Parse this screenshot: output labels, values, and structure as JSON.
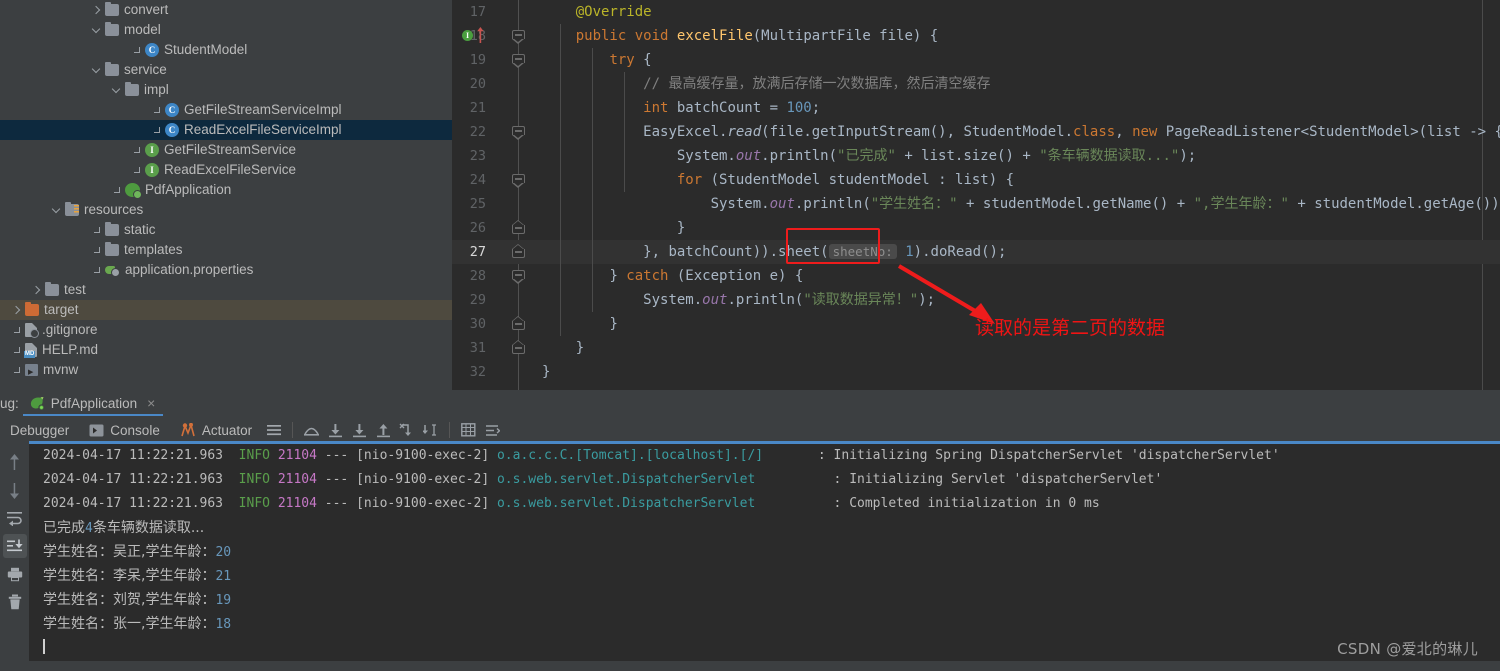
{
  "colors": {
    "editor_bg": "#2b2b2b",
    "panel_bg": "#3c3f41",
    "accent_blue": "#4a88c7",
    "selection_blue": "#0d293e",
    "annotation_red": "#ee1c1c",
    "string_green": "#6a8759",
    "keyword_orange": "#cc7832",
    "number_blue": "#6897bb"
  },
  "project_tree": {
    "items": [
      {
        "label": "convert",
        "indent": 5,
        "icon": "folder-icon",
        "chevron": "right",
        "state": "normal"
      },
      {
        "label": "model",
        "indent": 5,
        "icon": "folder-icon",
        "chevron": "down",
        "state": "normal"
      },
      {
        "label": "StudentModel",
        "indent": 7,
        "icon": "java-class-icon",
        "chevron": "none",
        "state": "normal"
      },
      {
        "label": "service",
        "indent": 5,
        "icon": "folder-icon",
        "chevron": "down",
        "state": "normal"
      },
      {
        "label": "impl",
        "indent": 6,
        "icon": "folder-icon",
        "chevron": "down",
        "state": "normal"
      },
      {
        "label": "GetFileStreamServiceImpl",
        "indent": 8,
        "icon": "java-class-icon",
        "chevron": "none",
        "state": "normal"
      },
      {
        "label": "ReadExcelFileServiceImpl",
        "indent": 8,
        "icon": "java-class-icon",
        "chevron": "none",
        "state": "selected"
      },
      {
        "label": "GetFileStreamService",
        "indent": 7,
        "icon": "java-interface-icon",
        "chevron": "none",
        "state": "normal"
      },
      {
        "label": "ReadExcelFileService",
        "indent": 7,
        "icon": "java-interface-icon",
        "chevron": "none",
        "state": "normal"
      },
      {
        "label": "PdfApplication",
        "indent": 6,
        "icon": "spring-boot-icon",
        "chevron": "none",
        "state": "normal"
      },
      {
        "label": "resources",
        "indent": 3,
        "icon": "resources-folder-icon",
        "chevron": "down",
        "state": "normal"
      },
      {
        "label": "static",
        "indent": 5,
        "icon": "folder-icon",
        "chevron": "none",
        "state": "normal"
      },
      {
        "label": "templates",
        "indent": 5,
        "icon": "folder-icon",
        "chevron": "none",
        "state": "normal"
      },
      {
        "label": "application.properties",
        "indent": 5,
        "icon": "properties-file-icon",
        "chevron": "none",
        "state": "normal"
      },
      {
        "label": "test",
        "indent": 2,
        "icon": "folder-icon",
        "chevron": "right",
        "state": "normal"
      },
      {
        "label": "target",
        "indent": 1,
        "icon": "target-folder-icon",
        "chevron": "right",
        "state": "highlighted"
      },
      {
        "label": ".gitignore",
        "indent": 1,
        "icon": "gitignore-file-icon",
        "chevron": "none",
        "state": "normal"
      },
      {
        "label": "HELP.md",
        "indent": 1,
        "icon": "markdown-file-icon",
        "chevron": "none",
        "state": "normal"
      },
      {
        "label": "mvnw",
        "indent": 1,
        "icon": "script-file-icon",
        "chevron": "none",
        "state": "normal"
      }
    ]
  },
  "editor": {
    "current_line": 27,
    "breakpoint_line": 18,
    "inlay_hint": "sheetNo:",
    "lines": [
      {
        "num": "17",
        "indent": 2,
        "tokens": [
          {
            "t": "anno",
            "v": "@Override"
          }
        ]
      },
      {
        "num": "18",
        "indent": 2,
        "tokens": [
          {
            "t": "kw",
            "v": "public "
          },
          {
            "t": "kw",
            "v": "void "
          },
          {
            "t": "meth",
            "v": "excelFile"
          },
          {
            "t": "def",
            "v": "(MultipartFile file) {"
          }
        ]
      },
      {
        "num": "19",
        "indent": 3,
        "tokens": [
          {
            "t": "kw",
            "v": "try"
          },
          {
            "t": "def",
            "v": " {"
          }
        ]
      },
      {
        "num": "20",
        "indent": 4,
        "tokens": [
          {
            "t": "cmt",
            "v": "// 最高缓存量，放满后存储一次数据库，然后清空缓存"
          }
        ]
      },
      {
        "num": "21",
        "indent": 4,
        "tokens": [
          {
            "t": "kw",
            "v": "int "
          },
          {
            "t": "def",
            "v": "batchCount = "
          },
          {
            "t": "num",
            "v": "100"
          },
          {
            "t": "def",
            "v": ";"
          }
        ]
      },
      {
        "num": "22",
        "indent": 4,
        "tokens": [
          {
            "t": "def",
            "v": "EasyExcel."
          },
          {
            "t": "stat",
            "v": "read"
          },
          {
            "t": "def",
            "v": "(file.getInputStream(), StudentModel."
          },
          {
            "t": "kw",
            "v": "class"
          },
          {
            "t": "def",
            "v": ", "
          },
          {
            "t": "kw",
            "v": "new "
          },
          {
            "t": "def",
            "v": "PageReadListener<StudentModel>(list -> {"
          }
        ]
      },
      {
        "num": "23",
        "indent": 5,
        "tokens": [
          {
            "t": "def",
            "v": "System."
          },
          {
            "t": "field",
            "v": "out"
          },
          {
            "t": "def",
            "v": ".println("
          },
          {
            "t": "str",
            "v": "\"已完成\""
          },
          {
            "t": "def",
            "v": " + list.size() + "
          },
          {
            "t": "str",
            "v": "\"条车辆数据读取...\""
          },
          {
            "t": "def",
            "v": ");"
          }
        ]
      },
      {
        "num": "24",
        "indent": 5,
        "tokens": [
          {
            "t": "kw",
            "v": "for "
          },
          {
            "t": "def",
            "v": "(StudentModel studentModel : list) {"
          }
        ]
      },
      {
        "num": "25",
        "indent": 6,
        "tokens": [
          {
            "t": "def",
            "v": "System."
          },
          {
            "t": "field",
            "v": "out"
          },
          {
            "t": "def",
            "v": ".println("
          },
          {
            "t": "str",
            "v": "\"学生姓名：\""
          },
          {
            "t": "def",
            "v": " + studentModel.getName() + "
          },
          {
            "t": "str",
            "v": "\",学生年龄：\""
          },
          {
            "t": "def",
            "v": " + studentModel.getAge());"
          }
        ]
      },
      {
        "num": "26",
        "indent": 5,
        "tokens": [
          {
            "t": "def",
            "v": "}"
          }
        ]
      },
      {
        "num": "27",
        "indent": 4,
        "tokens": [
          {
            "t": "def",
            "v": "}, batchCount)).sheet("
          },
          {
            "t": "hint",
            "v": "sheetNo:"
          },
          {
            "t": "num",
            "v": " 1"
          },
          {
            "t": "def",
            "v": ")"
          },
          {
            "t": "def",
            "v": ".doRead();"
          }
        ]
      },
      {
        "num": "28",
        "indent": 3,
        "tokens": [
          {
            "t": "def",
            "v": "} "
          },
          {
            "t": "kw",
            "v": "catch "
          },
          {
            "t": "def",
            "v": "(Exception e) {"
          }
        ]
      },
      {
        "num": "29",
        "indent": 4,
        "tokens": [
          {
            "t": "def",
            "v": "System."
          },
          {
            "t": "field",
            "v": "out"
          },
          {
            "t": "def",
            "v": ".println("
          },
          {
            "t": "str",
            "v": "\"读取数据异常！\""
          },
          {
            "t": "def",
            "v": ");"
          }
        ]
      },
      {
        "num": "30",
        "indent": 3,
        "tokens": [
          {
            "t": "def",
            "v": "}"
          }
        ]
      },
      {
        "num": "31",
        "indent": 2,
        "tokens": [
          {
            "t": "def",
            "v": "}"
          }
        ]
      },
      {
        "num": "32",
        "indent": 1,
        "tokens": [
          {
            "t": "def",
            "v": "}"
          }
        ]
      }
    ]
  },
  "annotation": {
    "text": "读取的是第二页的数据",
    "color": "#f01414"
  },
  "debug_panel": {
    "label": "ug:",
    "run_tab": {
      "title": "PdfApplication",
      "close": "×"
    },
    "tabs": [
      {
        "label": "Debugger",
        "icon": "debugger-icon",
        "active": false
      },
      {
        "label": "Console",
        "icon": "console-icon",
        "active": true
      },
      {
        "label": "Actuator",
        "icon": "actuator-icon",
        "active": false
      }
    ],
    "toolbar_buttons": [
      "menu-icon",
      "step-over-icon",
      "step-into-icon",
      "force-step-into-icon",
      "step-out-icon",
      "run-to-cursor-icon",
      "drop-frame-icon",
      "evaluate-icon",
      "settings-icon"
    ],
    "side_buttons": [
      {
        "name": "scroll-up-icon",
        "active": false
      },
      {
        "name": "scroll-down-icon",
        "active": false
      },
      {
        "name": "soft-wrap-icon",
        "active": false
      },
      {
        "name": "scroll-to-end-icon",
        "active": true
      },
      {
        "name": "print-icon",
        "active": false
      },
      {
        "name": "trash-icon",
        "active": false
      }
    ]
  },
  "console": {
    "log_lines": [
      {
        "date": "2024-04-17 11:22:21.963",
        "level": "INFO",
        "pid": "21104",
        "sep": "---",
        "thread": "[nio-9100-exec-2]",
        "logger": "o.a.c.c.C.[Tomcat].[localhost].[/]",
        "logger_pad": "       ",
        "message": ": Initializing Spring DispatcherServlet 'dispatcherServlet'"
      },
      {
        "date": "2024-04-17 11:22:21.963",
        "level": "INFO",
        "pid": "21104",
        "sep": "---",
        "thread": "[nio-9100-exec-2]",
        "logger": "o.s.web.servlet.DispatcherServlet",
        "logger_pad": "          ",
        "message": ": Initializing Servlet 'dispatcherServlet'"
      },
      {
        "date": "2024-04-17 11:22:21.963",
        "level": "INFO",
        "pid": "21104",
        "sep": "---",
        "thread": "[nio-9100-exec-2]",
        "logger": "o.s.web.servlet.DispatcherServlet",
        "logger_pad": "          ",
        "message": ": Completed initialization in 0 ms"
      }
    ],
    "output_lines": [
      {
        "pre": "已完成",
        "num": "4",
        "post": "条车辆数据读取..."
      },
      {
        "pre": "学生姓名：吴正,学生年龄：",
        "num": "20",
        "post": ""
      },
      {
        "pre": "学生姓名：李呆,学生年龄：",
        "num": "21",
        "post": ""
      },
      {
        "pre": "学生姓名：刘贺,学生年龄：",
        "num": "19",
        "post": ""
      },
      {
        "pre": "学生姓名：张一,学生年龄：",
        "num": "18",
        "post": ""
      }
    ]
  },
  "watermark": {
    "text": "CSDN @爱北的琳儿"
  }
}
